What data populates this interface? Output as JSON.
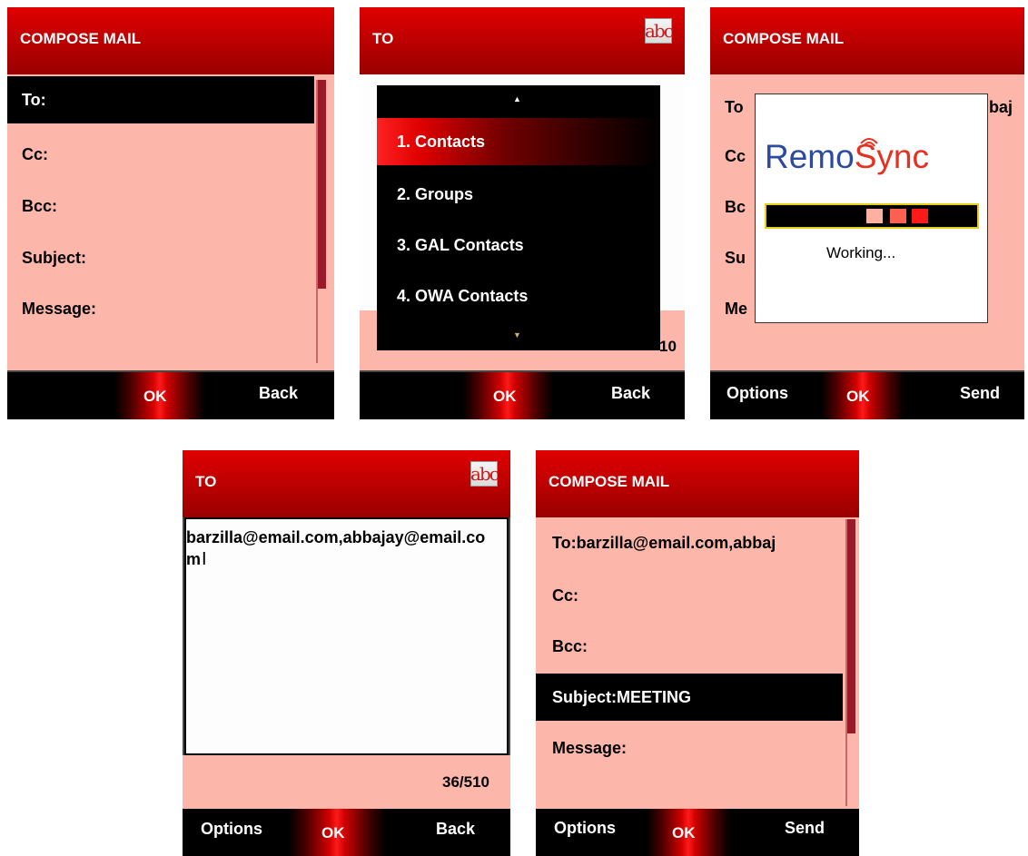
{
  "panel1": {
    "header_title": "COMPOSE MAIL",
    "fields": [
      {
        "label": "To:"
      },
      {
        "label": "Cc:"
      },
      {
        "label": "Bcc:"
      },
      {
        "label": "Subject:"
      },
      {
        "label": "Message:"
      }
    ],
    "ok_label": "OK",
    "right_soft": "Back"
  },
  "panel2": {
    "header_title": "TO",
    "input_mode_icon": "abc",
    "menu_items": [
      {
        "label": "1. Contacts"
      },
      {
        "label": "2. Groups"
      },
      {
        "label": "3. GAL Contacts"
      },
      {
        "label": "4. OWA Contacts"
      }
    ],
    "partial_counter": "10",
    "ok_label": "OK",
    "right_soft": "Back"
  },
  "panel3": {
    "header_title": "COMPOSE MAIL",
    "partial_fields": [
      "To",
      "Cc",
      "Bc",
      "Su",
      "Me"
    ],
    "partial_value": "baj",
    "logo_remo": "Rem",
    "logo_o": "o",
    "logo_sync": "Sync",
    "working_text": "Working...",
    "left_soft": "Options",
    "ok_label": "OK",
    "right_soft": "Send"
  },
  "panel4": {
    "header_title": "TO",
    "input_mode_icon": "abc",
    "to_value": "barzilla@email.com,abbajay@email.com",
    "counter": "36/510",
    "left_soft": "Options",
    "ok_label": "OK",
    "right_soft": "Back"
  },
  "panel5": {
    "header_title": "COMPOSE MAIL",
    "fields": [
      {
        "label": "To:barzilla@email.com,abbaj"
      },
      {
        "label": "Cc:"
      },
      {
        "label": "Bcc:"
      },
      {
        "label": "Subject:MEETING"
      },
      {
        "label": "Message:"
      }
    ],
    "left_soft": "Options",
    "ok_label": "OK",
    "right_soft": "Send"
  },
  "colors": {
    "header_red": "#c00000",
    "body_pink": "#fdb7aa",
    "selection": "#000000",
    "progress_border": "#e6cf1a"
  }
}
